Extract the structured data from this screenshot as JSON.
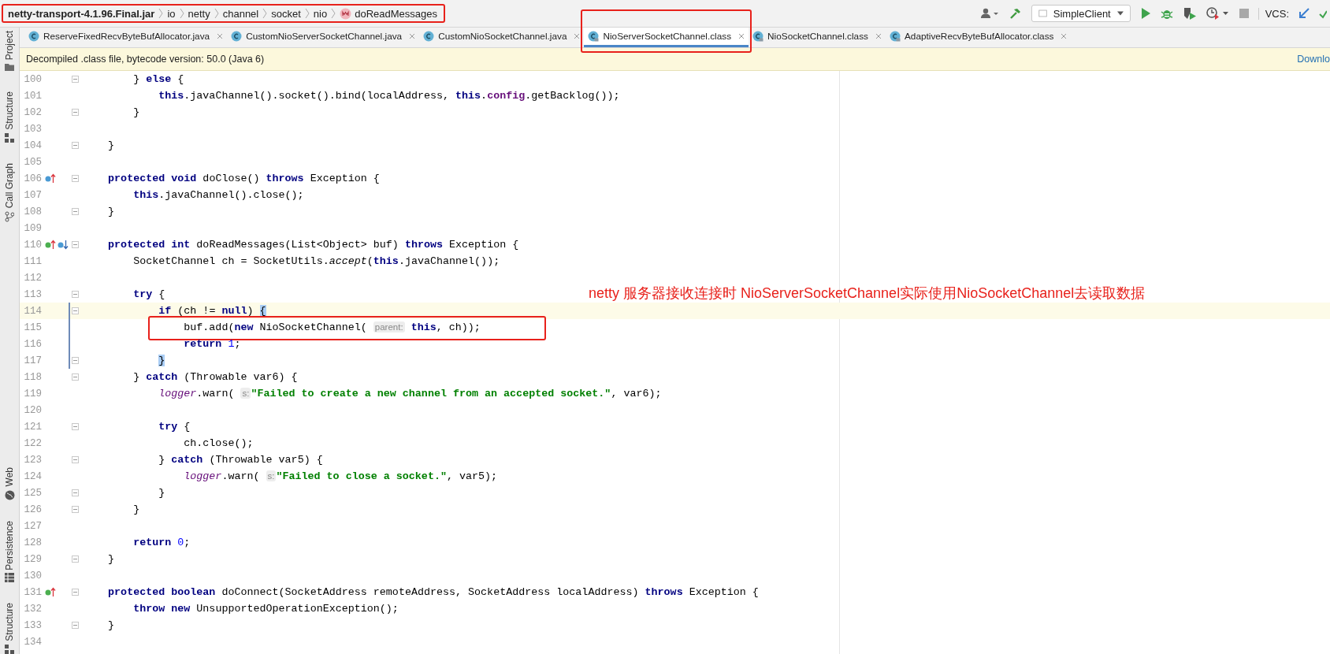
{
  "breadcrumb": {
    "framed": true,
    "items": [
      {
        "kind": "jar",
        "label": "netty-transport-4.1.96.Final.jar"
      },
      {
        "kind": "package",
        "label": "io"
      },
      {
        "kind": "package",
        "label": "netty"
      },
      {
        "kind": "package",
        "label": "channel"
      },
      {
        "kind": "package",
        "label": "socket"
      },
      {
        "kind": "package",
        "label": "nio"
      },
      {
        "kind": "method",
        "label": "doReadMessages"
      }
    ]
  },
  "toolbar": [
    {
      "kind": "user"
    },
    {
      "kind": "build"
    },
    {
      "kind": "run_config",
      "label": "SimpleClient"
    },
    {
      "kind": "run"
    },
    {
      "kind": "debug"
    },
    {
      "kind": "coverage"
    },
    {
      "kind": "profile"
    },
    {
      "kind": "stop"
    },
    {
      "kind": "vcs_label",
      "label": "VCS:"
    },
    {
      "kind": "vcs_update"
    },
    {
      "kind": "vcs_commit"
    }
  ],
  "tool_windows": {
    "top": [
      {
        "label": "Project",
        "kind": "folder"
      },
      {
        "label": "Structure",
        "kind": "structure"
      },
      {
        "label": "Call Graph",
        "kind": "graph"
      }
    ],
    "bottom": [
      {
        "label": "Web",
        "kind": "globe"
      },
      {
        "label": "Persistence",
        "kind": "db"
      },
      {
        "label": "Structure",
        "kind": "structure"
      }
    ]
  },
  "tabs": [
    {
      "label": "ReserveFixedRecvByteBufAllocator.java",
      "kind": "java",
      "selected": false,
      "framed": false
    },
    {
      "label": "CustomNioServerSocketChannel.java",
      "kind": "java",
      "selected": false,
      "framed": false
    },
    {
      "label": "CustomNioSocketChannel.java",
      "kind": "java",
      "selected": false,
      "framed": false
    },
    {
      "label": "NioServerSocketChannel.class",
      "kind": "class",
      "selected": true,
      "framed": true
    },
    {
      "label": "NioSocketChannel.class",
      "kind": "class",
      "selected": false,
      "framed": false
    },
    {
      "label": "AdaptiveRecvByteBufAllocator.class",
      "kind": "class",
      "selected": false,
      "framed": false
    }
  ],
  "info_bar": {
    "message": "Decompiled .class file, bytecode version: 50.0 (Java 6)",
    "link": "Downlo"
  },
  "lines": [
    {
      "number": "100",
      "fold": true,
      "tokens": [
        {
          "kind": "plain",
          "text": "        } "
        },
        {
          "kind": "kw",
          "text": "else"
        },
        {
          "kind": "plain",
          "text": " {"
        }
      ]
    },
    {
      "number": "101",
      "tokens": [
        {
          "kind": "kw",
          "text": "            this"
        },
        {
          "kind": "plain",
          "text": ".javaChannel().socket().bind(localAddress, "
        },
        {
          "kind": "kw",
          "text": "this"
        },
        {
          "kind": "plain",
          "text": "."
        },
        {
          "kind": "field",
          "text": "config"
        },
        {
          "kind": "plain",
          "text": ".getBacklog());"
        }
      ]
    },
    {
      "number": "102",
      "fold": true,
      "tokens": [
        {
          "kind": "plain",
          "text": "        }"
        }
      ]
    },
    {
      "number": "103"
    },
    {
      "number": "104",
      "fold": true,
      "tokens": [
        {
          "kind": "plain",
          "text": "    }"
        }
      ]
    },
    {
      "number": "105"
    },
    {
      "number": "106",
      "fold": true,
      "markers": [
        {
          "kind": "overrides_up"
        }
      ],
      "tokens": [
        {
          "kind": "kw",
          "text": "    protected void"
        },
        {
          "kind": "plain",
          "text": " doClose() "
        },
        {
          "kind": "kw",
          "text": "throws"
        },
        {
          "kind": "plain",
          "text": " Exception {"
        }
      ]
    },
    {
      "number": "107",
      "tokens": [
        {
          "kind": "kw",
          "text": "        this"
        },
        {
          "kind": "plain",
          "text": ".javaChannel().close();"
        }
      ]
    },
    {
      "number": "108",
      "fold": true,
      "tokens": [
        {
          "kind": "plain",
          "text": "    }"
        }
      ]
    },
    {
      "number": "109"
    },
    {
      "number": "110",
      "fold": true,
      "markers": [
        {
          "kind": "implements_up"
        },
        {
          "kind": "overridden_down"
        }
      ],
      "tokens": [
        {
          "kind": "kw",
          "text": "    protected int"
        },
        {
          "kind": "plain",
          "text": " doReadMessages(List<Object> buf) "
        },
        {
          "kind": "kw",
          "text": "throws"
        },
        {
          "kind": "plain",
          "text": " Exception {"
        }
      ]
    },
    {
      "number": "111",
      "tokens": [
        {
          "kind": "plain",
          "text": "        SocketChannel ch = SocketUtils."
        },
        {
          "kind": "static",
          "text": "accept"
        },
        {
          "kind": "plain",
          "text": "("
        },
        {
          "kind": "kw",
          "text": "this"
        },
        {
          "kind": "plain",
          "text": ".javaChannel());"
        }
      ]
    },
    {
      "number": "112"
    },
    {
      "number": "113",
      "fold": true,
      "tokens": [
        {
          "kind": "kw",
          "text": "        try"
        },
        {
          "kind": "plain",
          "text": " {"
        }
      ]
    },
    {
      "number": "114",
      "fold": true,
      "current": true,
      "modified": true,
      "note": "netty 服务器接收连接时 NioServerSocketChannel实际使用NioSocketChannel去读取数据",
      "tokens": [
        {
          "kind": "kw",
          "text": "            if"
        },
        {
          "kind": "plain",
          "text": " (ch != "
        },
        {
          "kind": "kw",
          "text": "null"
        },
        {
          "kind": "plain",
          "text": ") "
        },
        {
          "kind": "brace",
          "text": "{"
        }
      ]
    },
    {
      "number": "115",
      "modified": true,
      "framed": true,
      "tokens": [
        {
          "kind": "plain",
          "text": "                buf.add("
        },
        {
          "kind": "kw",
          "text": "new"
        },
        {
          "kind": "plain",
          "text": " NioSocketChannel( "
        },
        {
          "kind": "hint",
          "text": "parent:"
        },
        {
          "kind": "kw",
          "text": " this"
        },
        {
          "kind": "plain",
          "text": ", ch));"
        }
      ]
    },
    {
      "number": "116",
      "modified": true,
      "tokens": [
        {
          "kind": "kw",
          "text": "                return "
        },
        {
          "kind": "number",
          "text": "1"
        },
        {
          "kind": "plain",
          "text": ";"
        }
      ]
    },
    {
      "number": "117",
      "fold": true,
      "modified": true,
      "tokens": [
        {
          "kind": "brace",
          "text": "            }"
        }
      ]
    },
    {
      "number": "118",
      "fold": true,
      "tokens": [
        {
          "kind": "plain",
          "text": "        } "
        },
        {
          "kind": "kw",
          "text": "catch"
        },
        {
          "kind": "plain",
          "text": " (Throwable var6) {"
        }
      ]
    },
    {
      "number": "119",
      "tokens": [
        {
          "kind": "logger",
          "text": "            logger"
        },
        {
          "kind": "plain",
          "text": ".warn( "
        },
        {
          "kind": "hint",
          "text": "s:"
        },
        {
          "kind": "string",
          "text": "\"Failed to create a new channel from an accepted socket.\""
        },
        {
          "kind": "plain",
          "text": ", var6);"
        }
      ]
    },
    {
      "number": "120"
    },
    {
      "number": "121",
      "fold": true,
      "tokens": [
        {
          "kind": "kw",
          "text": "            try"
        },
        {
          "kind": "plain",
          "text": " {"
        }
      ]
    },
    {
      "number": "122",
      "tokens": [
        {
          "kind": "plain",
          "text": "                ch.close();"
        }
      ]
    },
    {
      "number": "123",
      "fold": true,
      "tokens": [
        {
          "kind": "plain",
          "text": "            } "
        },
        {
          "kind": "kw",
          "text": "catch"
        },
        {
          "kind": "plain",
          "text": " (Throwable var5) {"
        }
      ]
    },
    {
      "number": "124",
      "tokens": [
        {
          "kind": "logger",
          "text": "                logger"
        },
        {
          "kind": "plain",
          "text": ".warn( "
        },
        {
          "kind": "hint",
          "text": "s:"
        },
        {
          "kind": "string",
          "text": "\"Failed to close a socket.\""
        },
        {
          "kind": "plain",
          "text": ", var5);"
        }
      ]
    },
    {
      "number": "125",
      "fold": true,
      "tokens": [
        {
          "kind": "plain",
          "text": "            }"
        }
      ]
    },
    {
      "number": "126",
      "fold": true,
      "tokens": [
        {
          "kind": "plain",
          "text": "        }"
        }
      ]
    },
    {
      "number": "127"
    },
    {
      "number": "128",
      "tokens": [
        {
          "kind": "kw",
          "text": "        return "
        },
        {
          "kind": "number",
          "text": "0"
        },
        {
          "kind": "plain",
          "text": ";"
        }
      ]
    },
    {
      "number": "129",
      "fold": true,
      "tokens": [
        {
          "kind": "plain",
          "text": "    }"
        }
      ]
    },
    {
      "number": "130"
    },
    {
      "number": "131",
      "fold": true,
      "markers": [
        {
          "kind": "implements_up"
        }
      ],
      "tokens": [
        {
          "kind": "kw",
          "text": "    protected boolean"
        },
        {
          "kind": "plain",
          "text": " doConnect(SocketAddress remoteAddress, SocketAddress localAddress) "
        },
        {
          "kind": "kw",
          "text": "throws"
        },
        {
          "kind": "plain",
          "text": " Exception {"
        }
      ]
    },
    {
      "number": "132",
      "tokens": [
        {
          "kind": "kw",
          "text": "        throw new"
        },
        {
          "kind": "plain",
          "text": " UnsupportedOperationException();"
        }
      ]
    },
    {
      "number": "133",
      "fold": true,
      "tokens": [
        {
          "kind": "plain",
          "text": "    }"
        }
      ]
    },
    {
      "number": "134"
    }
  ]
}
